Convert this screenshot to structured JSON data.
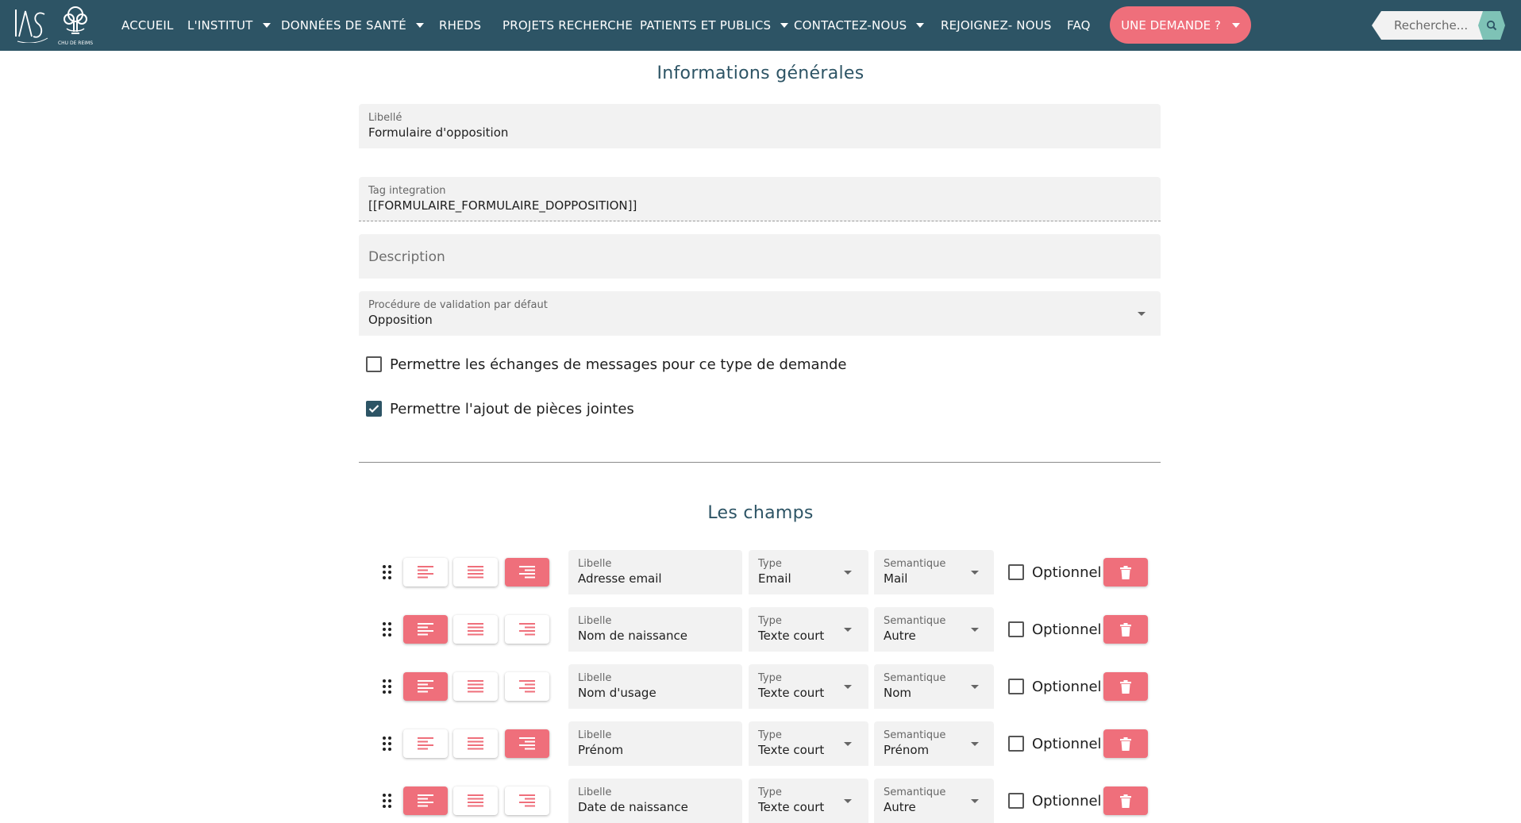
{
  "nav": {
    "logo_text": "CHU DE REIMS",
    "items": [
      "ACCUEIL",
      "L'INSTITUT",
      "DONNÉES DE SANTÉ",
      "RHEDS",
      "PROJETS RECHERCHE",
      "PATIENTS ET PUBLICS",
      "CONTACTEZ-NOUS",
      "REJOIGNEZ- NOUS",
      "FAQ"
    ],
    "cta_label": "UNE DEMANDE ?",
    "search_placeholder": "Recherche..."
  },
  "general": {
    "title": "Informations générales",
    "libelle_label": "Libellé",
    "libelle_value": "Formulaire d'opposition",
    "tag_label": "Tag integration",
    "tag_value": "[[FORMULAIRE_FORMULAIRE_DOPPOSITION]]",
    "description_placeholder": "Description",
    "procedure_label": "Procédure de validation par défaut",
    "procedure_value": "Opposition",
    "messages_label": "Permettre les échanges de messages pour ce type de demande",
    "messages_checked": false,
    "attachments_label": "Permettre l'ajout de pièces jointes",
    "attachments_checked": true
  },
  "fields_section": {
    "title": "Les champs",
    "libelle_label": "Libelle",
    "type_label": "Type",
    "semantic_label": "Semantique",
    "optional_label": "Optionnel",
    "rows": [
      {
        "libelle": "Adresse email",
        "type": "Email",
        "semantic": "Mail",
        "align": "right",
        "optional": false
      },
      {
        "libelle": "Nom de naissance",
        "type": "Texte court",
        "semantic": "Autre",
        "align": "left",
        "optional": false
      },
      {
        "libelle": "Nom d'usage",
        "type": "Texte court",
        "semantic": "Nom",
        "align": "left",
        "optional": false
      },
      {
        "libelle": "Prénom",
        "type": "Texte court",
        "semantic": "Prénom",
        "align": "right",
        "optional": false
      },
      {
        "libelle": "Date de naissance",
        "type": "Texte court",
        "semantic": "Autre",
        "align": "left",
        "optional": false
      }
    ]
  },
  "colors": {
    "nav_bg": "#2d5465",
    "accent": "#ef6f7b",
    "search_btn": "#7ec2b6",
    "title": "#2d5465"
  }
}
